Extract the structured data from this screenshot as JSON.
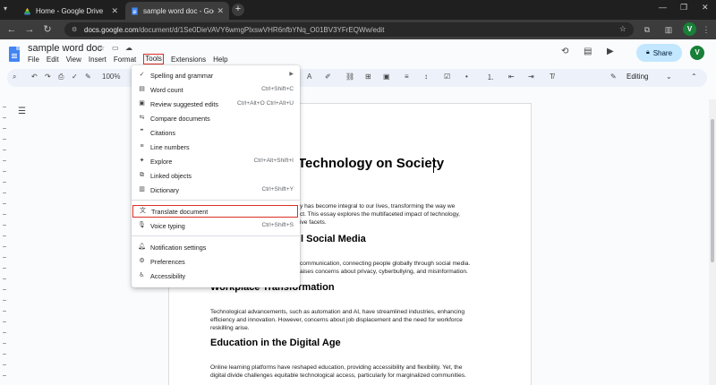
{
  "browser": {
    "tabs": [
      {
        "title": "Home - Google Drive",
        "active": false
      },
      {
        "title": "sample word doc - Google Do",
        "active": true
      }
    ],
    "new_tab": "+",
    "url_domain": "docs.google.com",
    "url_path": "/document/d/1Se0DieVAVY6wmgPlxswVHR6nfbYNq_O01BV3YFrEQWw/edit",
    "profile_initial": "V"
  },
  "docs": {
    "title": "sample word doc",
    "menu": [
      "File",
      "Edit",
      "View",
      "Insert",
      "Format",
      "Tools",
      "Extensions",
      "Help"
    ],
    "share_label": "Share",
    "avatar_initial": "V",
    "zoom": "100%",
    "mode": "Editing"
  },
  "tools_menu": {
    "items": [
      {
        "label": "Spelling and grammar",
        "shortcut": "",
        "submenu": true,
        "icon": "spellcheck-icon"
      },
      {
        "label": "Word count",
        "shortcut": "Ctrl+Shift+C",
        "icon": "word-count-icon"
      },
      {
        "label": "Review suggested edits",
        "shortcut": "Ctrl+Alt+O Ctrl+Alt+U",
        "icon": "review-edits-icon"
      },
      {
        "label": "Compare documents",
        "shortcut": "",
        "icon": "compare-icon"
      },
      {
        "label": "Citations",
        "shortcut": "",
        "icon": "quote-icon"
      },
      {
        "label": "Line numbers",
        "shortcut": "",
        "icon": "line-numbers-icon"
      },
      {
        "label": "Explore",
        "shortcut": "Ctrl+Alt+Shift+I",
        "icon": "explore-icon"
      },
      {
        "label": "Linked objects",
        "shortcut": "",
        "icon": "linked-objects-icon"
      },
      {
        "label": "Dictionary",
        "shortcut": "Ctrl+Shift+Y",
        "icon": "dictionary-icon"
      },
      {
        "label": "Translate document",
        "shortcut": "",
        "icon": "translate-icon",
        "highlighted": true
      },
      {
        "label": "Voice typing",
        "shortcut": "Ctrl+Shift+S",
        "icon": "microphone-icon"
      },
      {
        "label": "Notification settings",
        "shortcut": "",
        "icon": "bell-icon"
      },
      {
        "label": "Preferences",
        "shortcut": "",
        "icon": "preferences-icon"
      },
      {
        "label": "Accessibility",
        "shortcut": "",
        "icon": "accessibility-icon"
      }
    ]
  },
  "document": {
    "title_visible": "Technology on Society",
    "intro_line1": "y has become integral to our lives, transforming the way we",
    "intro_line2": "ct. This essay explores the multifaceted impact of technology,",
    "intro_line3": "ive facets.",
    "h_social": "l Social Media",
    "social_line1": "communication, connecting people globally through social media.",
    "social_line2": "aises concerns about privacy, cyberbullying, and misinformation.",
    "h_workplace": "Workplace Transformation",
    "work_line1": "Technological advancements, such as automation and AI, have streamlined industries, enhancing",
    "work_line2": "efficiency and innovation. However, concerns about job displacement and the need for workforce",
    "work_line3": "reskilling arise.",
    "h_education": "Education in the Digital Age",
    "edu_line1": "Online learning platforms have reshaped education, providing accessibility and flexibility. Yet, the",
    "edu_line2": "digital divide challenges equitable technological access, particularly for marginalized communities."
  },
  "colors": {
    "highlight": "#d93025",
    "share_bg": "#c2e7ff",
    "doc_blue": "#4285f4",
    "profile": "#188038"
  }
}
